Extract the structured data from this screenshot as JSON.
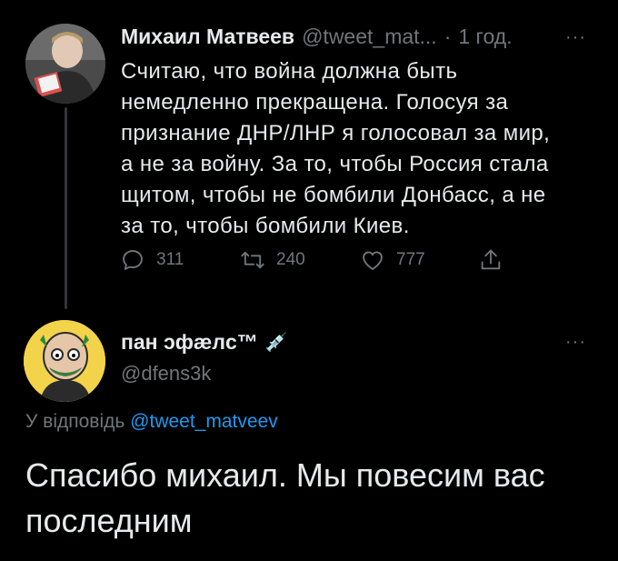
{
  "tweet1": {
    "name": "Михаил Матвеев",
    "handle": "@tweet_mat...",
    "separator": "·",
    "time": "1 год.",
    "more": "···",
    "text": "Считаю, что война должна быть\nнемедленно прекращена. Голосуя за\nпризнание ДНР/ЛНР я голосовал за мир,\nа не за войну. За то, чтобы Россия стала\nщитом, чтобы не бомбили Донбасс, а не\nза то, чтобы бомбили Киев.",
    "actions": {
      "replies": "311",
      "retweets": "240",
      "likes": "777"
    },
    "icons": [
      "reply-icon",
      "retweet-icon",
      "like-icon",
      "share-icon",
      "more-icon"
    ]
  },
  "tweet2": {
    "name": "пан ɔфæлc™",
    "name_emoji": "💉",
    "handle": "@dfens3k",
    "more": "···",
    "reply_prefix": "У відповідь",
    "reply_to": "@tweet_matveev",
    "text": "Спасибо михаил. Мы повесим вас\nпоследним"
  },
  "colors": {
    "background": "#000000",
    "text": "#e7e9ea",
    "muted": "#71767b",
    "link": "#1d9bf0",
    "thread_line": "#333639"
  }
}
